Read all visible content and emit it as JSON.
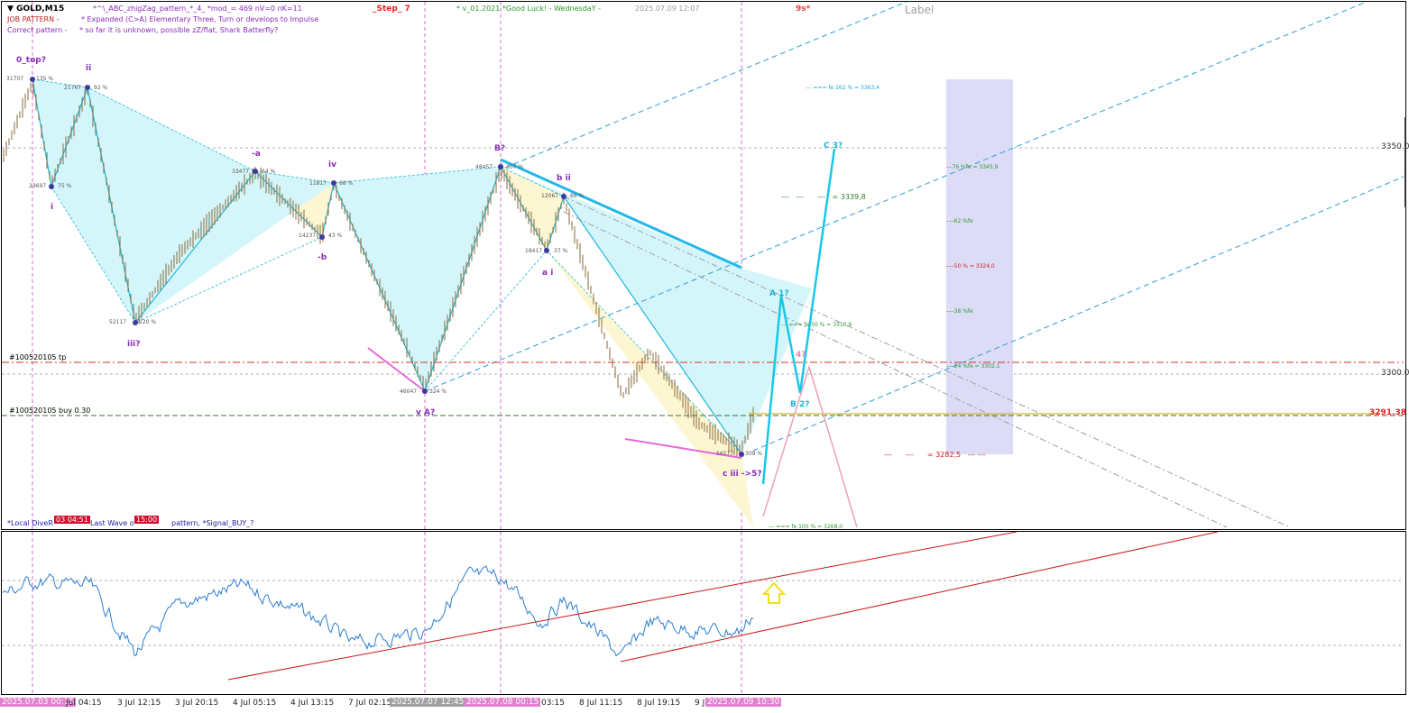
{
  "chart": {
    "symbol": "GOLD,M15",
    "header_line1": "*^\\_ABC_zhigZag_pattern_*_4_  *mod_= 469   nV=0   nK=11",
    "step": "_Step_ 7",
    "version": "* v_01.2021  *Good Luck!   - WednesdaY -",
    "timestamp": "2025.07.09 12:07",
    "top_badge": "9s*",
    "label_watermark": "Label",
    "job_pattern_label": "JOB PATTERN  -",
    "job_pattern_text": "* Expanded (C>A) Elementary Three, Turn or develops to Impulse",
    "correct_pattern_label": "Correct pattern -",
    "correct_pattern_text": "* so far it is unknown, possible zZ/flat, Shark Batterfly?",
    "bottom_note_a": "*Local DiveR",
    "bottom_note_b": "Last Wave o",
    "bottom_note_c": "pattern, *Signal_BUY_?",
    "timer_tag_1": "03 04:51",
    "timer_tag_2": "15:00"
  },
  "order_lines": {
    "tp_label": "#100520105 tp",
    "buy_label": "#100520105 buy 0.30",
    "buy_price": "3291.38"
  },
  "price_axis": [
    "3350.0",
    "3300.0"
  ],
  "time_axis": {
    "highlighted_start": "2025.07.03 00:15",
    "labels": [
      "Jul 04:15",
      "3 Jul 12:15",
      "3 Jul 20:15",
      "4 Jul 05:15",
      "4 Jul 13:15",
      "7 Jul 02:15",
      "03:15",
      "8 Jul 11:15",
      "8 Jul 19:15",
      "9 J"
    ],
    "highlighted_mid1": "2025.07.07 12:45",
    "highlighted_mid2": "2025.07.08 00:15",
    "highlighted_end": "2025.07.09 10:30"
  },
  "wave_labels": {
    "top": "0_top?",
    "ii": "ii",
    "i": "i",
    "iii": "iii?",
    "minus_a": "-a",
    "minus_b": "-b",
    "iv": "iv",
    "vA": "v A?",
    "B": "B?",
    "bii": "b ii",
    "ai": "a i",
    "ciii": "c iii ->5?",
    "A1": "A  1?",
    "B2": "B  2?",
    "C3": "C  3?",
    "w4": "4?"
  },
  "point_labels": {
    "p1": "31707",
    "p1pct": "135 %",
    "p2": "21767",
    "p2pct": "92 %",
    "p3": "23697",
    "p3pct": "75 %",
    "p4": "52117",
    "p4pct": "220 %",
    "p5": "33477",
    "p5pct": "64 %",
    "p6": "11817",
    "p6pct": "68 %",
    "p7": "14237",
    "p7pct": "43 %",
    "p8": "46047",
    "p8pct": "324 %",
    "p9": "48457",
    "p9pct": "107 %",
    "p10": "12067",
    "p10pct": "66 %",
    "p11": "18417",
    "p11pct": "37 %",
    "p12": "56577",
    "p12pct": "309 %"
  },
  "fib_levels": {
    "f162": "fe 162 % = 3363,4",
    "f76": "76 %fe = 3345,9",
    "f62": "62 %fe",
    "f50": "50 % = 3324,0",
    "f38": "38 %fe",
    "f24": "24 %fe = 3302,1",
    "f50b": "fe 50 % = 3310,9",
    "target1": "= 3339,8",
    "target2": "= 3282,5",
    "bottom": "fe 100 % = 3268,0"
  },
  "colors": {
    "cyan": "#1ec8e6",
    "pink": "#e868d8",
    "purple": "#8a2bb8",
    "order_red": "#d83020",
    "buy_green": "#2a7a2a",
    "oscillator_blue": "#2c7fd0",
    "trend_red": "#c81818"
  }
}
